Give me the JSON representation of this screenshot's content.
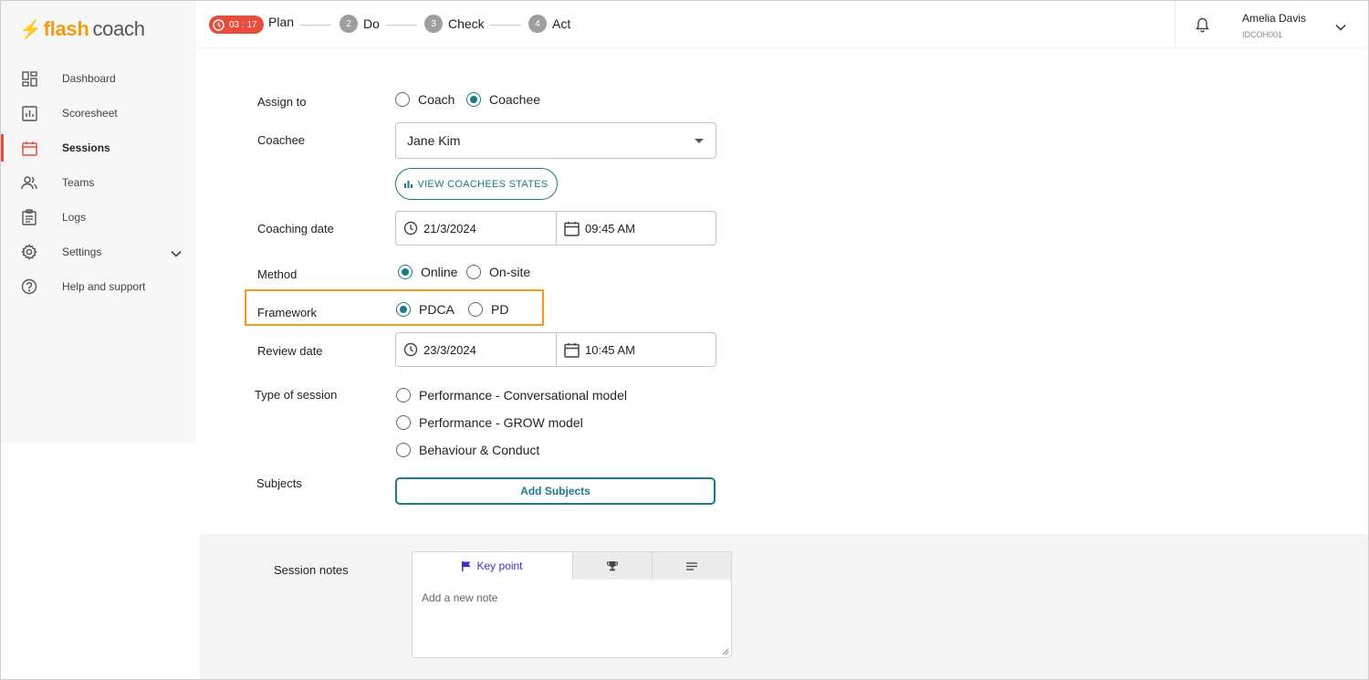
{
  "brand": {
    "flash": "flash",
    "coach": "coach",
    "accent": "#f39c12"
  },
  "sidebar": {
    "items": [
      {
        "label": "Dashboard",
        "icon": "dashboard-icon"
      },
      {
        "label": "Scoresheet",
        "icon": "chart-icon"
      },
      {
        "label": "Sessions",
        "icon": "calendar-icon",
        "active": true
      },
      {
        "label": "Teams",
        "icon": "team-icon"
      },
      {
        "label": "Logs",
        "icon": "clipboard-icon"
      },
      {
        "label": "Settings",
        "icon": "gear-icon"
      },
      {
        "label": "Help and support",
        "icon": "help-icon"
      }
    ]
  },
  "topbar": {
    "timer": "03 : 17",
    "steps": [
      {
        "label": "Plan",
        "number": ""
      },
      {
        "label": "Do",
        "number": "2"
      },
      {
        "label": "Check",
        "number": "3"
      },
      {
        "label": "Act",
        "number": "4"
      }
    ],
    "user": {
      "name": "Amelia Davis",
      "id": "IDCOH001"
    }
  },
  "form": {
    "assign_to": {
      "label": "Assign to",
      "options": [
        "Coach",
        "Coachee"
      ],
      "selected": "Coachee"
    },
    "coachee": {
      "label": "Coachee",
      "value": "Jane Kim"
    },
    "view_states_button": "VIEW COACHEES STATES",
    "coaching_date": {
      "label": "Coaching date",
      "date": "21/3/2024",
      "time": "09:45 AM"
    },
    "method": {
      "label": "Method",
      "options": [
        "Online",
        "On-site"
      ],
      "selected": "Online"
    },
    "framework": {
      "label": "Framework",
      "options": [
        "PDCA",
        "PD"
      ],
      "selected": "PDCA"
    },
    "review_date": {
      "label": "Review date",
      "date": "23/3/2024",
      "time": "10:45 AM"
    },
    "session_type": {
      "label": "Type of session",
      "options": [
        "Performance - Conversational model",
        "Performance - GROW model",
        "Behaviour & Conduct"
      ]
    },
    "subjects": {
      "label": "Subjects",
      "button": "Add Subjects"
    }
  },
  "notes": {
    "label": "Session notes",
    "tab_keypoint": "Key point",
    "placeholder": "Add a new note"
  },
  "colors": {
    "primary": "#1a7a8a",
    "timer": "#e74c3c",
    "highlight": "#f39c1f",
    "tab_active": "#3b2fc9"
  }
}
